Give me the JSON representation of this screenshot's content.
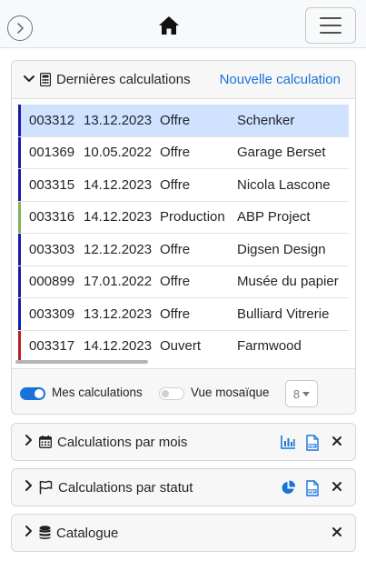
{
  "navbar": {
    "back_icon": "chevron-right-circle-icon",
    "home_icon": "home-icon",
    "menu_icon": "hamburger-menu-icon"
  },
  "recent": {
    "title": "Dernières calculations",
    "new_link": "Nouvelle calculation",
    "rows": [
      {
        "num": "003312",
        "date": "13.12.2023",
        "type": "Offre",
        "client": "Schenker",
        "color": "#1a1aa8",
        "selected": true
      },
      {
        "num": "001369",
        "date": "10.05.2022",
        "type": "Offre",
        "client": "Garage Berset",
        "color": "#1a1aa8",
        "selected": false
      },
      {
        "num": "003315",
        "date": "14.12.2023",
        "type": "Offre",
        "client": "Nicola Lascone",
        "color": "#1a1aa8",
        "selected": false
      },
      {
        "num": "003316",
        "date": "14.12.2023",
        "type": "Production",
        "client": "ABP Project",
        "color": "#7db35c",
        "selected": false
      },
      {
        "num": "003303",
        "date": "12.12.2023",
        "type": "Offre",
        "client": "Digsen Design",
        "color": "#1a1aa8",
        "selected": false
      },
      {
        "num": "000899",
        "date": "17.01.2022",
        "type": "Offre",
        "client": "Musée du papier",
        "color": "#1a1aa8",
        "selected": false
      },
      {
        "num": "003309",
        "date": "13.12.2023",
        "type": "Offre",
        "client": "Bulliard Vitrerie",
        "color": "#1a1aa8",
        "selected": false
      },
      {
        "num": "003317",
        "date": "14.12.2023",
        "type": "Ouvert",
        "client": "Farmwood",
        "color": "#b22222",
        "selected": false
      }
    ],
    "footer": {
      "mine_label": "Mes calculations",
      "mine_on": true,
      "mosaic_label": "Vue mosaïque",
      "mosaic_on": false,
      "count": "8"
    }
  },
  "panels": {
    "month": {
      "title": "Calculations par mois",
      "icons": [
        "bar-chart-icon",
        "pdf-file-icon",
        "close-icon"
      ]
    },
    "status": {
      "title": "Calculations par statut",
      "icons": [
        "pie-chart-icon",
        "pdf-file-icon",
        "close-icon"
      ]
    },
    "catalog": {
      "title": "Catalogue",
      "icons": [
        "close-icon"
      ]
    }
  },
  "colors": {
    "accent": "#1a73d9",
    "selected_row": "#cfe2ff",
    "offer": "#1a1aa8",
    "production": "#7db35c",
    "open": "#b22222"
  }
}
